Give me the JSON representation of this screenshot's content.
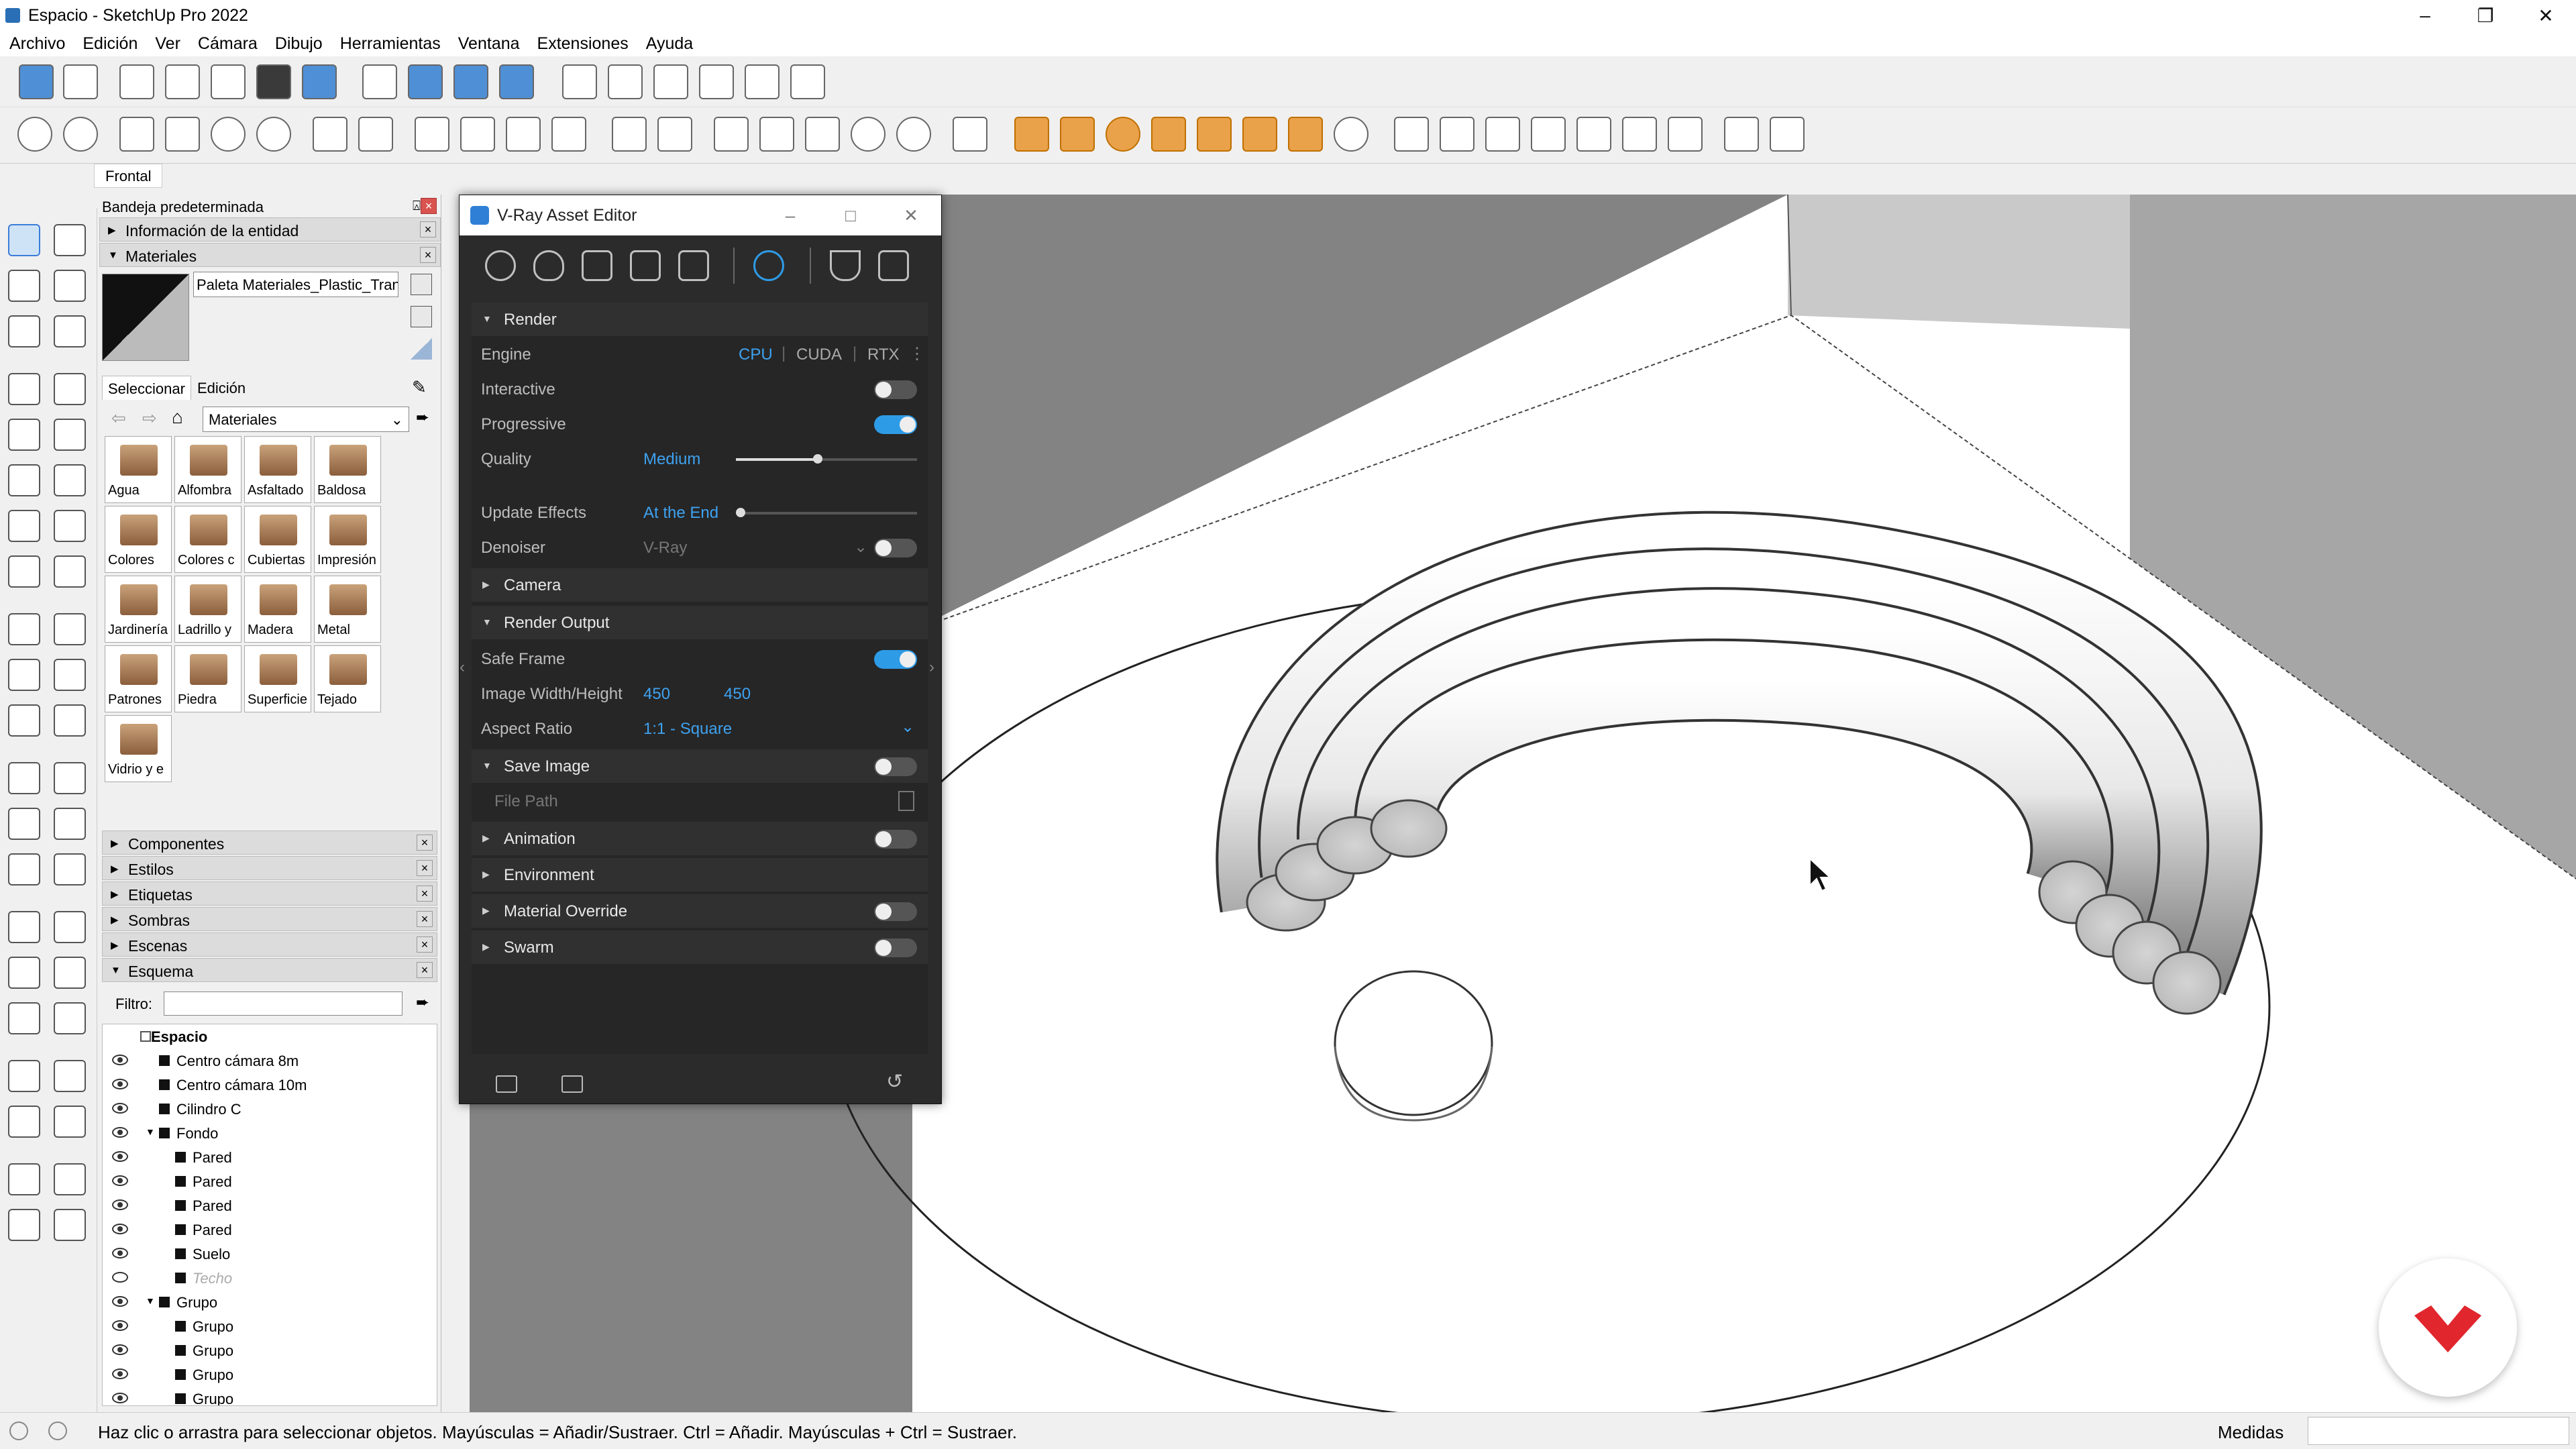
{
  "window": {
    "title": "Espacio - SketchUp Pro 2022",
    "minimize": "–",
    "restore": "❐",
    "close": "✕"
  },
  "menu": [
    "Archivo",
    "Edición",
    "Ver",
    "Cámara",
    "Dibujo",
    "Herramientas",
    "Ventana",
    "Extensiones",
    "Ayuda"
  ],
  "scene_tab": "Frontal",
  "tray": {
    "title": "Bandeja predeterminada",
    "pin": "⍓",
    "close": "×",
    "entity_info": "Información de la entidad",
    "materials_header": "Materiales",
    "material_name": "Paleta Materiales_Plastic_Trans",
    "tabs": {
      "select": "Seleccionar",
      "edit": "Edición"
    },
    "library": "Materiales",
    "swatches": [
      "Agua",
      "Alfombra",
      "Asfaltado",
      "Baldosa",
      "Colores",
      "Colores c",
      "Cubiertas",
      "Impresión",
      "Jardinería",
      "Ladrillo y",
      "Madera",
      "Metal",
      "Patrones",
      "Piedra",
      "Superficie",
      "Tejado",
      "Vidrio y e"
    ],
    "panels": [
      "Componentes",
      "Estilos",
      "Etiquetas",
      "Sombras",
      "Escenas",
      "Esquema"
    ],
    "filter_label": "Filtro:",
    "outliner": [
      {
        "name": "Espacio",
        "depth": 0,
        "root": true
      },
      {
        "name": "Centro cámara 8m",
        "depth": 1
      },
      {
        "name": "Centro cámara 10m",
        "depth": 1
      },
      {
        "name": "Cilindro C",
        "depth": 1
      },
      {
        "name": "Fondo",
        "depth": 1,
        "expanded": true
      },
      {
        "name": "Pared",
        "depth": 2
      },
      {
        "name": "Pared",
        "depth": 2
      },
      {
        "name": "Pared",
        "depth": 2
      },
      {
        "name": "Pared",
        "depth": 2
      },
      {
        "name": "Suelo",
        "depth": 2
      },
      {
        "name": "Techo",
        "depth": 2,
        "hidden": true
      },
      {
        "name": "Grupo",
        "depth": 1,
        "expanded": true
      },
      {
        "name": "Grupo",
        "depth": 2
      },
      {
        "name": "Grupo",
        "depth": 2
      },
      {
        "name": "Grupo",
        "depth": 2
      },
      {
        "name": "Grupo",
        "depth": 2
      }
    ]
  },
  "vray": {
    "title": "V-Ray Asset Editor",
    "render": {
      "header": "Render",
      "engine_label": "Engine",
      "engines": [
        "CPU",
        "CUDA",
        "RTX"
      ],
      "interactive_label": "Interactive",
      "interactive": false,
      "progressive_label": "Progressive",
      "progressive": true,
      "quality_label": "Quality",
      "quality": "Medium",
      "quality_level": 0.45,
      "update_label": "Update Effects",
      "update": "At the End",
      "update_level": 0.0,
      "denoiser_label": "Denoiser",
      "denoiser": "V-Ray",
      "denoiser_on": false
    },
    "camera": "Camera",
    "render_output": {
      "header": "Render Output",
      "safe_frame_label": "Safe Frame",
      "safe_frame": true,
      "size_label": "Image Width/Height",
      "width": "450",
      "height": "450",
      "aspect_label": "Aspect Ratio",
      "aspect": "1:1 - Square"
    },
    "save_image": {
      "header": "Save Image",
      "on": false,
      "file_path": "File Path"
    },
    "animation": {
      "header": "Animation",
      "on": false
    },
    "environment": "Environment",
    "material_override": {
      "header": "Material Override",
      "on": false
    },
    "swarm": {
      "header": "Swarm",
      "on": false
    }
  },
  "status": {
    "message": "Haz clic o arrastra para seleccionar objetos. Mayúsculas = Añadir/Sustraer. Ctrl = Añadir. Mayúsculas + Ctrl = Sustraer.",
    "measure_label": "Medidas"
  },
  "colors": {
    "accent": "#2e9be6",
    "vray_bg": "#2b2b2b",
    "logo": "#e1262d"
  }
}
